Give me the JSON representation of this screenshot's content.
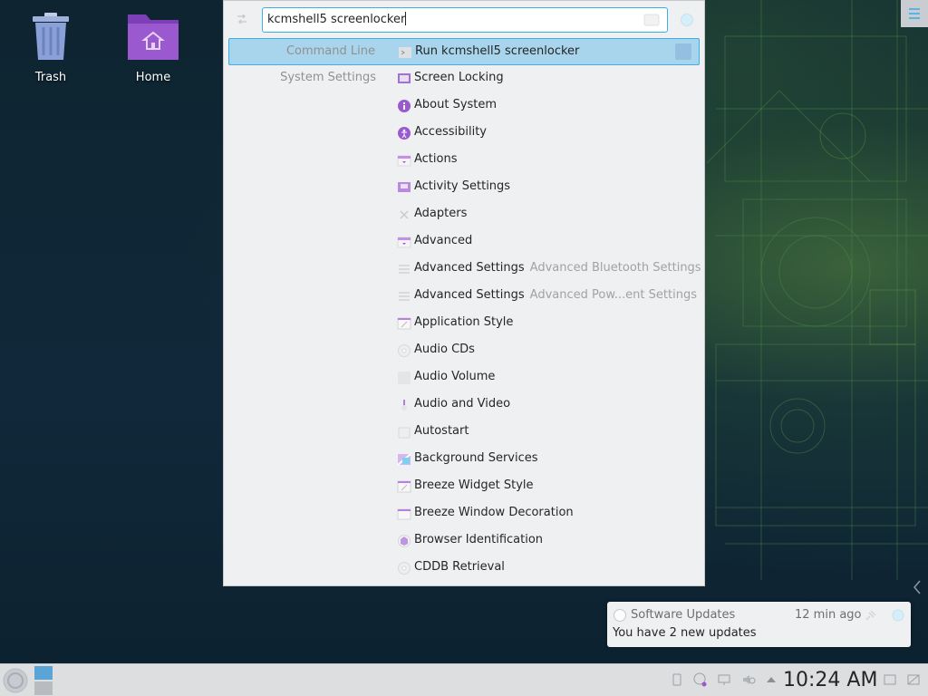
{
  "desktop": {
    "icons": [
      {
        "name": "trash",
        "label": "Trash"
      },
      {
        "name": "home",
        "label": "Home"
      }
    ]
  },
  "krunner": {
    "query": "kcmshell5 screenlocker",
    "results": [
      {
        "category": "Command Line",
        "icon": "terminal-icon",
        "title": "Run kcmshell5 screenlocker",
        "subtitle": "",
        "selected": true
      },
      {
        "category": "System Settings",
        "icon": "screen-locking-icon",
        "title": "Screen Locking",
        "subtitle": ""
      },
      {
        "category": "",
        "icon": "info-icon",
        "title": "About System",
        "subtitle": ""
      },
      {
        "category": "",
        "icon": "accessibility-icon",
        "title": "Accessibility",
        "subtitle": ""
      },
      {
        "category": "",
        "icon": "actions-icon",
        "title": "Actions",
        "subtitle": ""
      },
      {
        "category": "",
        "icon": "activity-settings-icon",
        "title": "Activity Settings",
        "subtitle": ""
      },
      {
        "category": "",
        "icon": "adapters-icon",
        "title": "Adapters",
        "subtitle": ""
      },
      {
        "category": "",
        "icon": "advanced-icon",
        "title": "Advanced",
        "subtitle": ""
      },
      {
        "category": "",
        "icon": "settings-list-icon",
        "title": "Advanced Settings",
        "subtitle": "Advanced Bluetooth Settings"
      },
      {
        "category": "",
        "icon": "settings-list-icon",
        "title": "Advanced Settings",
        "subtitle": "Advanced Pow...ent Settings"
      },
      {
        "category": "",
        "icon": "application-style-icon",
        "title": "Application Style",
        "subtitle": ""
      },
      {
        "category": "",
        "icon": "audio-cd-icon",
        "title": "Audio CDs",
        "subtitle": ""
      },
      {
        "category": "",
        "icon": "audio-volume-icon",
        "title": "Audio Volume",
        "subtitle": ""
      },
      {
        "category": "",
        "icon": "audio-video-icon",
        "title": "Audio and Video",
        "subtitle": ""
      },
      {
        "category": "",
        "icon": "autostart-icon",
        "title": "Autostart",
        "subtitle": ""
      },
      {
        "category": "",
        "icon": "background-services-icon",
        "title": "Background Services",
        "subtitle": ""
      },
      {
        "category": "",
        "icon": "breeze-widget-icon",
        "title": "Breeze Widget Style",
        "subtitle": ""
      },
      {
        "category": "",
        "icon": "window-decoration-icon",
        "title": "Breeze Window Decoration",
        "subtitle": ""
      },
      {
        "category": "",
        "icon": "browser-identification-icon",
        "title": "Browser Identification",
        "subtitle": ""
      },
      {
        "category": "",
        "icon": "cddb-icon",
        "title": "CDDB Retrieval",
        "subtitle": ""
      }
    ]
  },
  "notification": {
    "title": "Software Updates",
    "time": "12 min ago",
    "body": "You have 2 new updates"
  },
  "taskbar": {
    "clock": "10:24 AM"
  },
  "colors": {
    "accent": "#3daee9",
    "selection": "#a8d5ec",
    "folder": "#9b59d0",
    "panel": "#eff0f1"
  }
}
